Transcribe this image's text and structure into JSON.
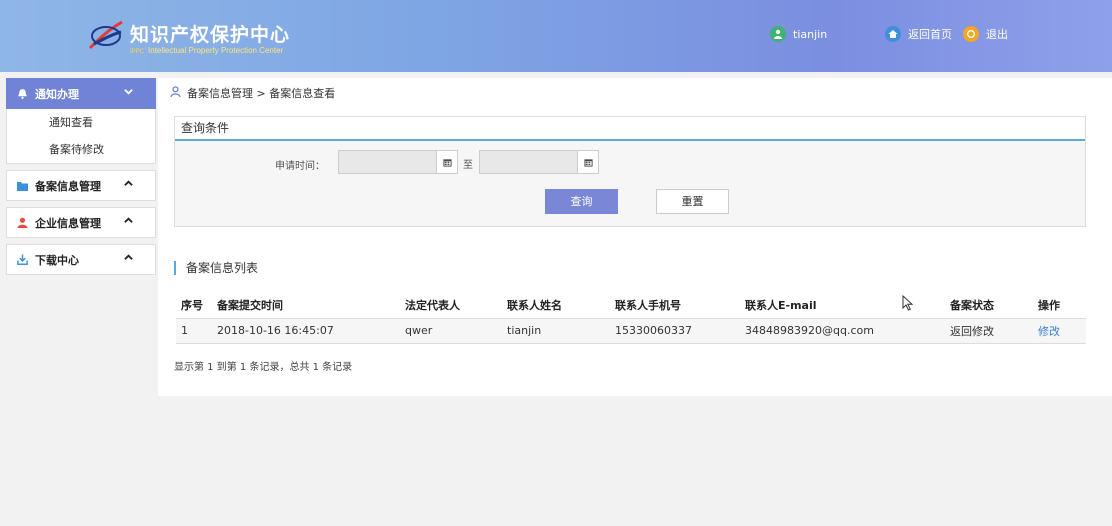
{
  "header": {
    "title": "知识产权保护中心",
    "subtitle_prefix": "IPPC",
    "subtitle": "Intellectual Property Protection Center",
    "user": "tianjin",
    "home_label": "返回首页",
    "exit_label": "退出"
  },
  "sidebar": {
    "menus": [
      {
        "label": "通知办理",
        "icon": "bell-icon",
        "expanded": true,
        "items": [
          {
            "label": "通知查看"
          },
          {
            "label": "备案待修改"
          }
        ]
      },
      {
        "label": "备案信息管理",
        "icon": "folder-icon",
        "expanded": false
      },
      {
        "label": "企业信息管理",
        "icon": "user-icon",
        "expanded": false
      },
      {
        "label": "下载中心",
        "icon": "download-icon",
        "expanded": false
      }
    ]
  },
  "breadcrumb": {
    "path": "备案信息管理 > 备案信息查看"
  },
  "query": {
    "title": "查询条件",
    "date_label": "申请时间：",
    "to_label": "至",
    "start_value": "",
    "end_value": "",
    "search_button": "查询",
    "reset_button": "重置"
  },
  "list": {
    "title": "备案信息列表",
    "columns": [
      "序号",
      "备案提交时间",
      "法定代表人",
      "联系人姓名",
      "联系人手机号",
      "联系人E-mail",
      "备案状态",
      "操作"
    ],
    "rows": [
      [
        "1",
        "2018-10-16 16:45:07",
        "qwer",
        "tianjin",
        "15330060337",
        "34848983920@qq.com",
        "返回修改",
        "修改"
      ]
    ],
    "summary": "显示第 1 到第 1 条记录，总共 1 条记录"
  },
  "colors": {
    "header_gradient_start": "#8fb6e6",
    "header_gradient_end": "#8fa0ea",
    "accent": "#7083d6",
    "title_underline": "#5ba8dc",
    "link": "#3a7fcf"
  }
}
